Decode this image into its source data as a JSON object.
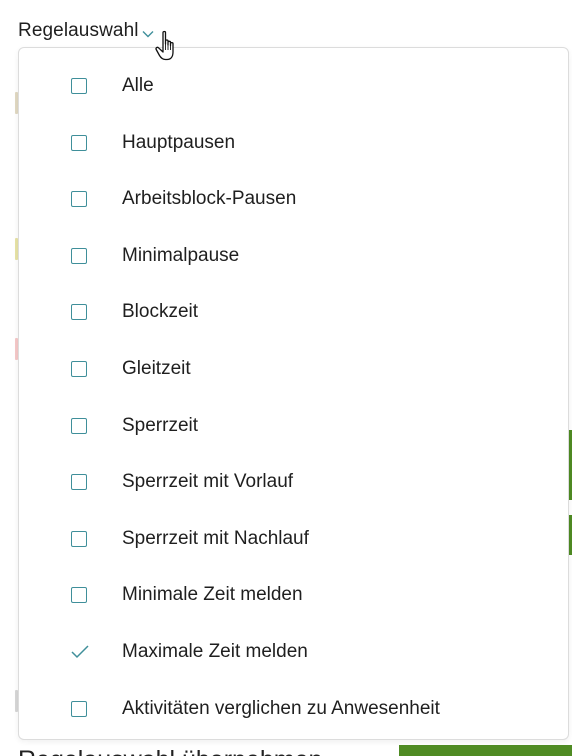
{
  "header": {
    "label": "Regelauswahl",
    "chevron_icon": "chevron-down-icon",
    "cursor_icon": "hand-pointer-icon"
  },
  "background": {
    "partial_text": "Regelauswahl übernehmen",
    "accent_color": "#4f8b23"
  },
  "dropdown": {
    "accent_color": "#3f8f9a",
    "options": [
      {
        "label": "Alle",
        "checked": false
      },
      {
        "label": "Hauptpausen",
        "checked": false
      },
      {
        "label": "Arbeitsblock-Pausen",
        "checked": false
      },
      {
        "label": "Minimalpause",
        "checked": false
      },
      {
        "label": "Blockzeit",
        "checked": false
      },
      {
        "label": "Gleitzeit",
        "checked": false
      },
      {
        "label": "Sperrzeit",
        "checked": false
      },
      {
        "label": "Sperrzeit mit Vorlauf",
        "checked": false
      },
      {
        "label": "Sperrzeit mit Nachlauf",
        "checked": false
      },
      {
        "label": "Minimale Zeit melden",
        "checked": false
      },
      {
        "label": "Maximale Zeit melden",
        "checked": true
      },
      {
        "label": "Aktivitäten verglichen zu Anwesenheit",
        "checked": false
      }
    ]
  }
}
